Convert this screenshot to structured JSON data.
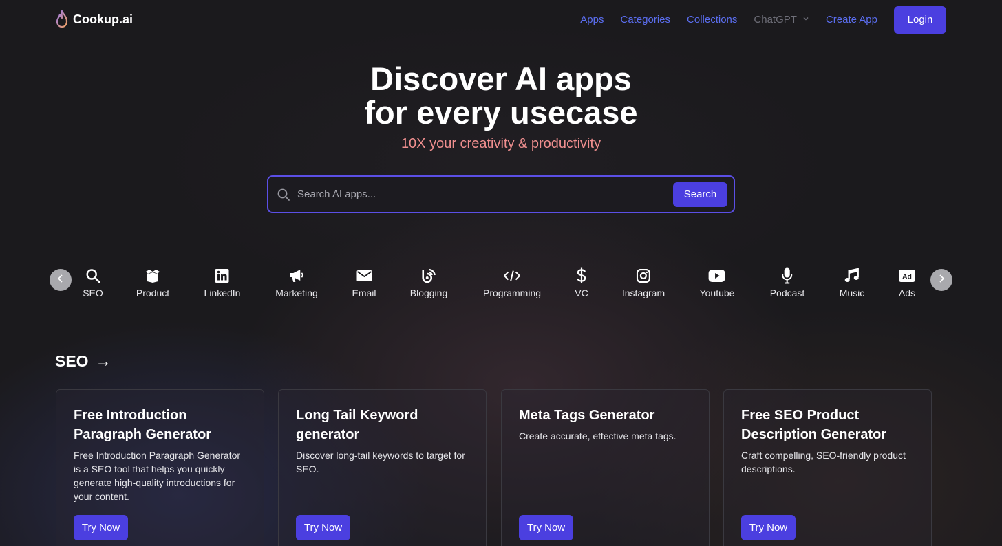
{
  "header": {
    "logo_text": "Cookup.ai",
    "nav": {
      "apps": "Apps",
      "categories": "Categories",
      "collections": "Collections",
      "chatgpt": "ChatGPT",
      "create_app": "Create App"
    },
    "login_label": "Login"
  },
  "hero": {
    "title_line1": "Discover AI apps",
    "title_line2": "for every usecase",
    "subtitle": "10X your creativity & productivity"
  },
  "search": {
    "placeholder": "Search AI apps...",
    "button_label": "Search"
  },
  "categories": [
    {
      "label": "SEO",
      "icon": "search-icon"
    },
    {
      "label": "Product",
      "icon": "box-icon"
    },
    {
      "label": "LinkedIn",
      "icon": "linkedin-icon"
    },
    {
      "label": "Marketing",
      "icon": "megaphone-icon"
    },
    {
      "label": "Email",
      "icon": "envelope-icon"
    },
    {
      "label": "Blogging",
      "icon": "blog-icon"
    },
    {
      "label": "Programming",
      "icon": "code-icon"
    },
    {
      "label": "VC",
      "icon": "dollar-icon"
    },
    {
      "label": "Instagram",
      "icon": "instagram-icon"
    },
    {
      "label": "Youtube",
      "icon": "youtube-icon"
    },
    {
      "label": "Podcast",
      "icon": "microphone-icon"
    },
    {
      "label": "Music",
      "icon": "music-note-icon"
    },
    {
      "label": "Ads",
      "icon": "ad-icon"
    }
  ],
  "ad_icon_text": "Ad",
  "section": {
    "title": "SEO",
    "arrow": "→"
  },
  "cards": [
    {
      "title": "Free Introduction Paragraph Generator",
      "description": "Free Introduction Paragraph Generator is a SEO tool that helps you quickly generate high-quality introductions for your content.",
      "button_label": "Try Now"
    },
    {
      "title": "Long Tail Keyword generator",
      "description": "Discover long-tail keywords to target for SEO.",
      "button_label": "Try Now"
    },
    {
      "title": "Meta Tags Generator",
      "description": "Create accurate, effective meta tags.",
      "button_label": "Try Now"
    },
    {
      "title": "Free SEO Product Description Generator",
      "description": "Craft compelling, SEO-friendly product descriptions.",
      "button_label": "Try Now"
    }
  ],
  "colors": {
    "accent": "#4b3fe0",
    "nav_link": "#5b6ef0",
    "subtitle": "#f08f8f",
    "background": "#1b1a1d"
  }
}
